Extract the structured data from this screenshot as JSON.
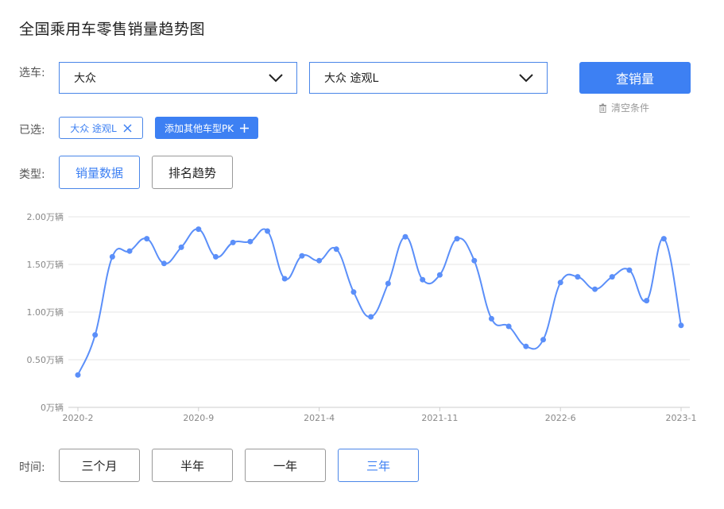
{
  "title": "全国乘用车零售销量趋势图",
  "select_row": {
    "label": "选车:",
    "brand_value": "大众",
    "model_value": "大众 途观L",
    "query_button": "查销量",
    "clear_label": "清空条件"
  },
  "selected_row": {
    "label": "已选:",
    "tag_label": "大众 途观L",
    "add_button": "添加其他车型PK"
  },
  "type_row": {
    "label": "类型:",
    "options": [
      "销量数据",
      "排名趋势"
    ],
    "active": 0
  },
  "time_row": {
    "label": "时间:",
    "options": [
      "三个月",
      "半年",
      "一年",
      "三年"
    ],
    "active": 3
  },
  "colors": {
    "accent": "#3d80f3",
    "line": "#5b8ff9",
    "grid": "#e6e6e6"
  },
  "chart_data": {
    "type": "line",
    "x": [
      "2020-2",
      "2020-3",
      "2020-4",
      "2020-5",
      "2020-6",
      "2020-7",
      "2020-8",
      "2020-9",
      "2020-10",
      "2020-11",
      "2020-12",
      "2021-1",
      "2021-2",
      "2021-3",
      "2021-4",
      "2021-5",
      "2021-6",
      "2021-7",
      "2021-8",
      "2021-9",
      "2021-10",
      "2021-11",
      "2021-12",
      "2022-1",
      "2022-2",
      "2022-3",
      "2022-4",
      "2022-5",
      "2022-6",
      "2022-7",
      "2022-8",
      "2022-9",
      "2022-10",
      "2022-11",
      "2022-12",
      "2023-1"
    ],
    "x_tick_labels": [
      "2020-2",
      "2020-9",
      "2021-4",
      "2021-11",
      "2022-6",
      "2023-1"
    ],
    "series": [
      {
        "values": [
          0.34,
          0.76,
          1.58,
          1.64,
          1.77,
          1.51,
          1.68,
          1.87,
          1.58,
          1.73,
          1.74,
          1.85,
          1.35,
          1.59,
          1.54,
          1.66,
          1.21,
          0.95,
          1.3,
          1.79,
          1.34,
          1.39,
          1.77,
          1.54,
          0.93,
          0.85,
          0.64,
          0.71,
          1.31,
          1.37,
          1.24,
          1.37,
          1.44,
          1.12,
          1.77,
          0.86
        ]
      }
    ],
    "y_ticks": [
      "0万辆",
      "0.50万辆",
      "1.00万辆",
      "1.50万辆",
      "2.00万辆"
    ],
    "ylim": [
      0,
      2.0
    ],
    "grid": true
  }
}
